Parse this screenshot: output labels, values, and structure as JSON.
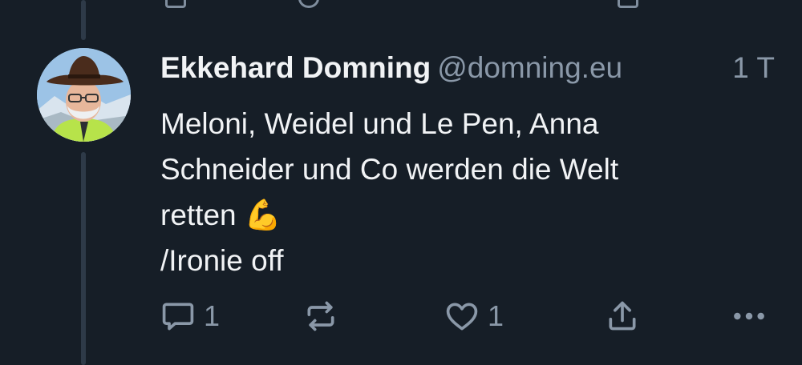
{
  "post": {
    "author_name": "Ekkehard Domning",
    "handle": "@domning.eu",
    "timestamp": "1 T",
    "lines": [
      "Meloni, Weidel und Le Pen, Anna",
      "Schneider und Co werden die Welt",
      "retten 💪",
      "/Ironie off"
    ]
  },
  "actions": {
    "reply_count": "1",
    "like_count": "1"
  },
  "colors": {
    "background": "#161e27",
    "text": "#f1f3f5",
    "muted": "#8a98a8",
    "thread_line": "#2e3a48",
    "like_pink": "#ec4899"
  },
  "icons": [
    "reply-icon",
    "repost-icon",
    "like-icon",
    "share-icon",
    "more-icon"
  ]
}
